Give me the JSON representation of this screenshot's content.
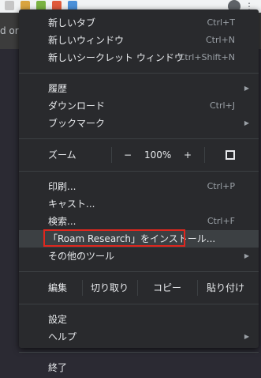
{
  "background": {
    "partial_text": "d or"
  },
  "menu": {
    "group1": [
      {
        "label": "新しいタブ",
        "shortcut": "Ctrl+T"
      },
      {
        "label": "新しいウィンドウ",
        "shortcut": "Ctrl+N"
      },
      {
        "label": "新しいシークレット ウィンドウ",
        "shortcut": "Ctrl+Shift+N"
      }
    ],
    "group2": [
      {
        "label": "履歴",
        "shortcut": ""
      },
      {
        "label": "ダウンロード",
        "shortcut": "Ctrl+J"
      },
      {
        "label": "ブックマーク",
        "shortcut": ""
      }
    ],
    "zoom": {
      "label": "ズーム",
      "minus": "−",
      "value": "100%",
      "plus": "+"
    },
    "group3": [
      {
        "label": "印刷...",
        "shortcut": "Ctrl+P"
      },
      {
        "label": "キャスト...",
        "shortcut": ""
      },
      {
        "label": "検索...",
        "shortcut": "Ctrl+F"
      },
      {
        "label": "「Roam Research」をインストール...",
        "shortcut": ""
      },
      {
        "label": "その他のツール",
        "shortcut": ""
      }
    ],
    "edit": {
      "label": "編集",
      "cut": "切り取り",
      "copy": "コピー",
      "paste": "貼り付け"
    },
    "group4": [
      {
        "label": "設定",
        "shortcut": ""
      },
      {
        "label": "ヘルプ",
        "shortcut": ""
      }
    ],
    "exit": {
      "label": "終了"
    }
  },
  "colors": {
    "menu_bg": "#292a2d",
    "highlight_bg": "#3c4043",
    "annotation_red": "#e0271e"
  }
}
